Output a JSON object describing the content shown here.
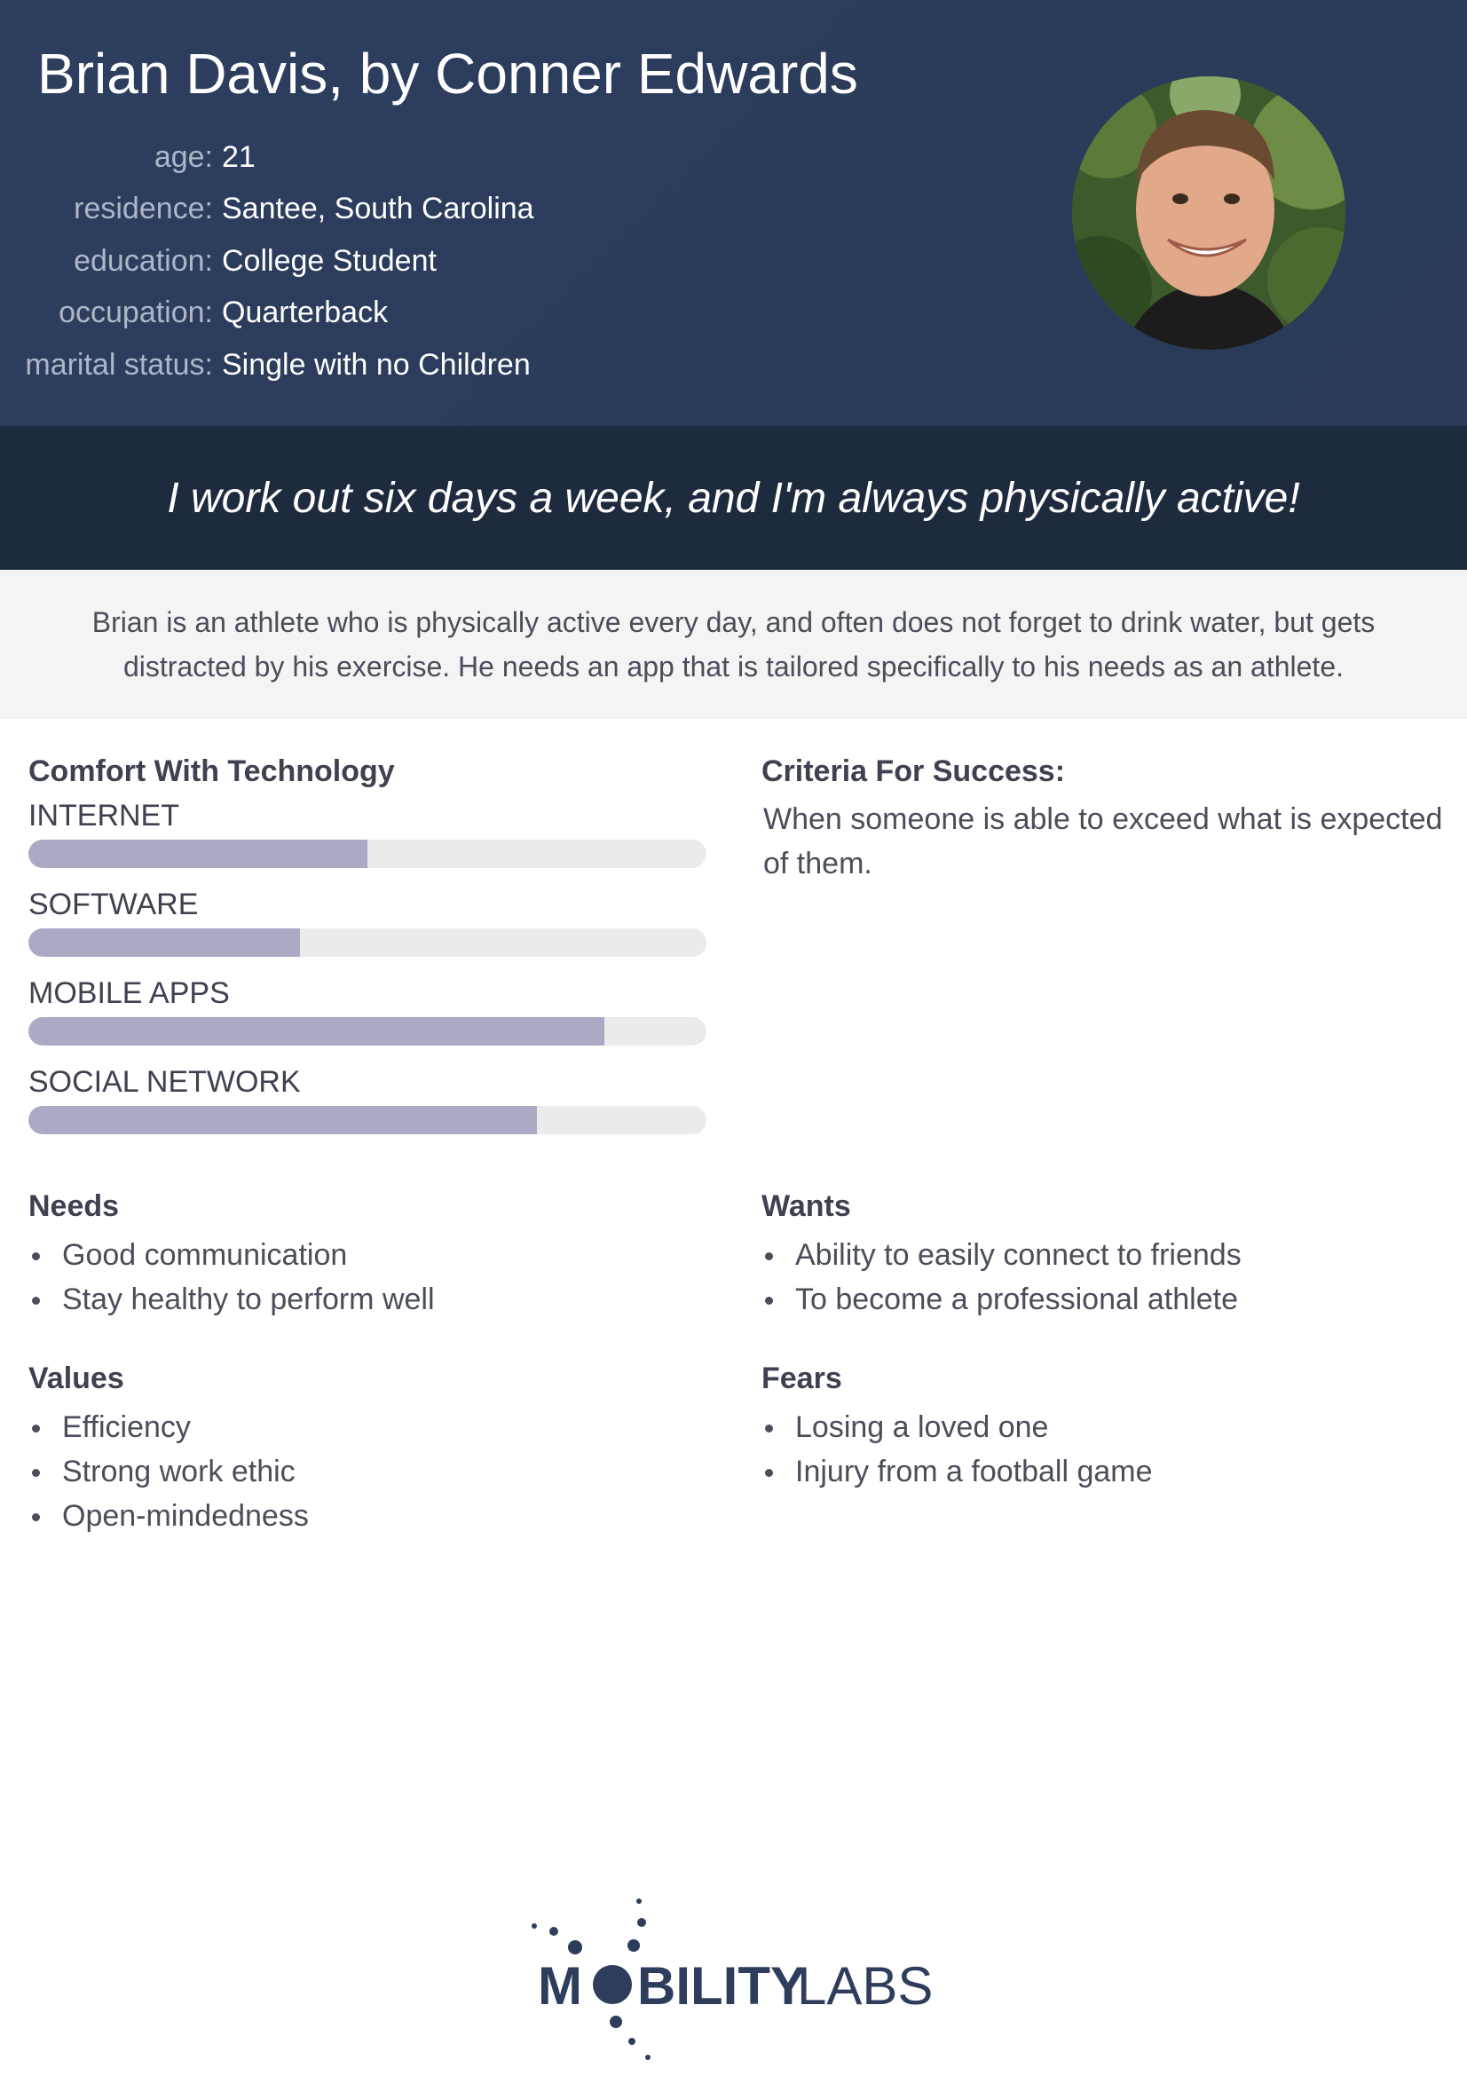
{
  "header": {
    "title": "Brian Davis, by Conner Edwards",
    "attributes": [
      {
        "label": "age:",
        "value": "21"
      },
      {
        "label": "residence:",
        "value": "Santee, South Carolina"
      },
      {
        "label": "education:",
        "value": "College Student"
      },
      {
        "label": "occupation:",
        "value": "Quarterback"
      },
      {
        "label": "marital status:",
        "value": "Single with no Children"
      }
    ],
    "photo_alt": "persona-photo"
  },
  "quote": "I work out six days a week, and I'm always physically active!",
  "summary": "Brian is an athlete who is physically active every day, and often does not forget to drink water, but gets distracted by his exercise. He needs an app that is tailored specifically to his needs as an athlete.",
  "comfort": {
    "heading": "Comfort With Technology",
    "items": [
      {
        "label": "INTERNET",
        "level": 0.5
      },
      {
        "label": "SOFTWARE",
        "level": 0.4
      },
      {
        "label": "MOBILE APPS",
        "level": 0.85
      },
      {
        "label": "SOCIAL NETWORK",
        "level": 0.75
      }
    ]
  },
  "criteria": {
    "heading": "Criteria For Success:",
    "text": "When someone is able to exceed what is expected of them."
  },
  "needs": {
    "heading": "Needs",
    "items": [
      "Good communication",
      "Stay healthy to perform well"
    ]
  },
  "wants": {
    "heading": "Wants",
    "items": [
      "Ability to easily connect to friends",
      "To become a professional athlete"
    ]
  },
  "values": {
    "heading": "Values",
    "items": [
      "Efficiency",
      "Strong work ethic",
      "Open-mindedness"
    ]
  },
  "fears": {
    "heading": "Fears",
    "items": [
      "Losing a loved one",
      "Injury from a football game"
    ]
  },
  "logo": {
    "text_a": "M",
    "text_b": "BILITY",
    "text_c": "LABS",
    "color": "#2f3d5c"
  },
  "colors": {
    "header": "#2d3e5f",
    "quote_band": "#1e2a3d",
    "bar_fill": "#aaaac4",
    "bar_track": "#ebebeb"
  }
}
